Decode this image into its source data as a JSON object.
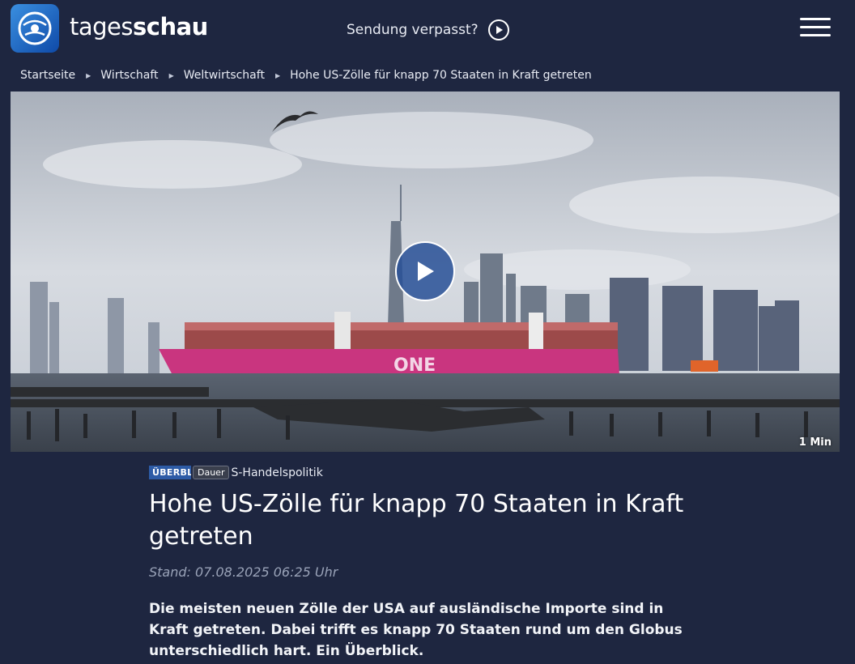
{
  "header": {
    "brand_part1": "tages",
    "brand_part2": "schau",
    "missed_label": "Sendung verpasst?"
  },
  "breadcrumb": [
    "Startseite",
    "Wirtschaft",
    "Weltwirtschaft",
    "Hohe US-Zölle für knapp 70 Staaten in Kraft getreten"
  ],
  "hero": {
    "duration": "1 Min",
    "ship_lettering": "ONE"
  },
  "article": {
    "tag": "ÜBERBLICK",
    "duration_badge": "Dauer",
    "topline": "S-Handelspolitik",
    "headline": "Hohe US-Zölle für knapp 70 Staaten in Kraft getreten",
    "dateline": "Stand: 07.08.2025 06:25 Uhr",
    "teaser": "Die meisten neuen Zölle der USA auf ausländische Importe sind in Kraft getreten. Dabei trifft es knapp 70 Staaten rund um den Globus unterschiedlich hart. Ein Überblick."
  },
  "colors": {
    "background": "#1e2640",
    "accent": "#2d5ba6",
    "ship_hull": "#c9357f"
  }
}
